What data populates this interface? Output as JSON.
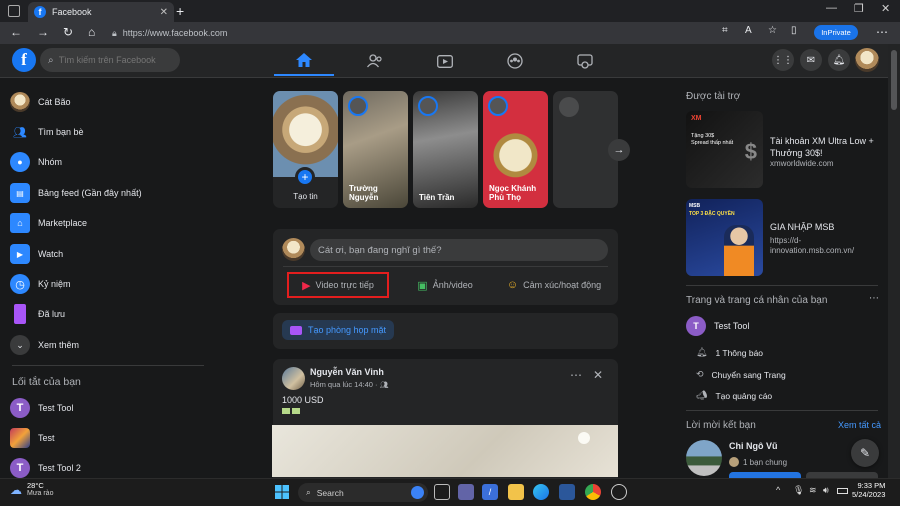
{
  "browser": {
    "tab_title": "Facebook",
    "url": "https://www.facebook.com",
    "inprivate_label": "InPrivate"
  },
  "header": {
    "search_placeholder": "Tìm kiếm trên Facebook"
  },
  "sidebar": {
    "items": [
      {
        "label": "Cát Bão",
        "icon": "profile-avatar"
      },
      {
        "label": "Tìm bạn bè",
        "icon": "friends-icon"
      },
      {
        "label": "Nhóm",
        "icon": "groups-icon"
      },
      {
        "label": "Bảng feed (Gần đây nhất)",
        "icon": "feed-icon"
      },
      {
        "label": "Marketplace",
        "icon": "marketplace-icon"
      },
      {
        "label": "Watch",
        "icon": "watch-icon"
      },
      {
        "label": "Kỷ niệm",
        "icon": "memories-icon"
      },
      {
        "label": "Đã lưu",
        "icon": "saved-icon"
      },
      {
        "label": "Xem thêm",
        "icon": "chevron-down-icon"
      }
    ],
    "shortcuts_title": "Lối tắt của bạn",
    "shortcuts": [
      {
        "label": "Test Tool"
      },
      {
        "label": "Test"
      },
      {
        "label": "Test Tool 2"
      }
    ]
  },
  "stories": [
    {
      "name": "Tạo tin"
    },
    {
      "name": "Trường\nNguyễn"
    },
    {
      "name": "Tiên Trần"
    },
    {
      "name": "Ngọc Khánh\nPhù Thọ"
    }
  ],
  "composer": {
    "placeholder": "Cát ơi, bạn đang nghĩ gì thế?",
    "live_video": "Video trực tiếp",
    "photo_video": "Ảnh/video",
    "feeling": "Cảm xúc/hoạt động"
  },
  "room": {
    "label": "Tạo phòng họp mặt"
  },
  "post": {
    "author": "Nguyễn Văn Vinh",
    "time": "Hôm qua lúc 14:40 · ",
    "text": "1000 USD"
  },
  "right": {
    "sponsored_title": "Được tài trợ",
    "ads": [
      {
        "title": "Tài khoản XM Ultra Low + Thưởng 30$!",
        "url": "xmworldwide.com",
        "img_text": "Tặng 30$\nSpread thấp nhất",
        "brand": "XM"
      },
      {
        "title": "GIA NHẬP MSB",
        "url": "https://d-innovation.msb.com.vn/",
        "img_text": "TOP 3 ĐẶC QUYỀN",
        "brand": "MSB"
      }
    ],
    "pages_title": "Trang và trang cá nhân của bạn",
    "page_name": "Test Tool",
    "page_actions": [
      "1 Thông báo",
      "Chuyển sang Trang",
      "Tạo quảng cáo"
    ],
    "friend_req_title": "Lời mời kết bạn",
    "see_all": "Xem tất cả",
    "friend_name": "Chi Ngô Vũ",
    "mutual": "1 bạn chung"
  },
  "taskbar": {
    "temp": "28°C",
    "weather": "Mưa rào",
    "search_label": "Search",
    "time": "9:33 PM",
    "date": "5/24/2023"
  },
  "colors": {
    "fb_blue": "#1877f2",
    "bg": "#18191a",
    "card": "#242526",
    "highlight_red": "#e41e1e"
  }
}
